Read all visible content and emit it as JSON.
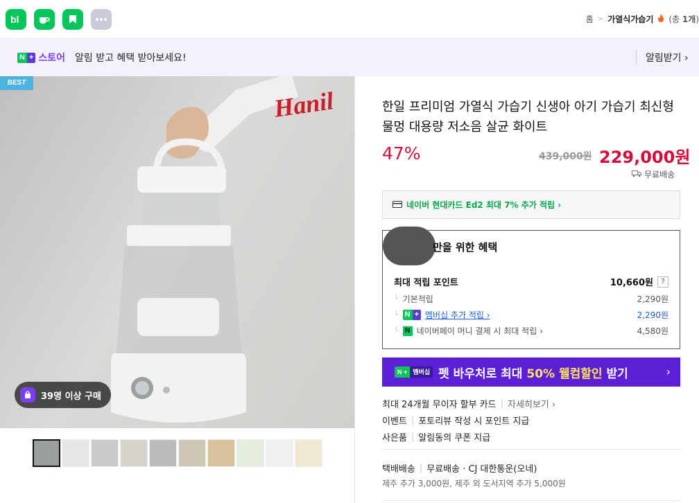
{
  "breadcrumb": {
    "home": "홈",
    "current": "가열식가습기",
    "count_prefix": "(총 ",
    "count_bold": "1개",
    "count_suffix": ")"
  },
  "notice": {
    "badge_n": "N",
    "badge_plus": "+",
    "store": "스토어",
    "message": "알림 받고 혜택 받아보세요!",
    "subscribe": "알림받기 ›"
  },
  "gallery": {
    "best_tag": "BEST",
    "brand_logo": "Hanil",
    "buyers": "39명 이상 구매",
    "thumb_count": 10
  },
  "product": {
    "title": "한일 프리미엄 가열식 가습기 신생아 아기 가습기 최신형 물멍 대용량 저소음 살균 화이트",
    "discount": "47%",
    "original_price": "439,000원",
    "price": "229,000원",
    "shipping": "무료배송"
  },
  "card_offer": {
    "text": "네이버 현대카드 Ed2 최대 7% 추가 적립 ›"
  },
  "benefit": {
    "header": "만을 위한 혜택",
    "max_points_label": "최대 적립 포인트",
    "max_points_value": "10,660원",
    "help": "?",
    "rows": [
      {
        "label": "기본적립",
        "value": "2,290원"
      },
      {
        "label": "멤버십 추가 적립 ›",
        "value": "2,290원"
      },
      {
        "label": "네이버페이 머니 결제 시 최대 적립 ›",
        "value": "4,580원"
      }
    ]
  },
  "promo": {
    "badge_n": "N +",
    "badge_m": "멤버십",
    "text_a": "펫 바우처로 최대 ",
    "text_hl": "50% 웰컴할인",
    "text_b": " 받기",
    "arrow": "›"
  },
  "info": {
    "installment": "최대 24개월 무이자 할부 카드",
    "installment_more": "자세히보기 ›",
    "event_label": "이벤트",
    "event_text": "포토리뷰 작성 시 포인트 지급",
    "gift_label": "사은품",
    "gift_text": "알림동의 쿠폰 지급",
    "delivery_label": "택배배송",
    "delivery_text": "무료배송 · CJ 대한통운(오네)",
    "delivery_extra": "제주 추가 3,000원, 제주 외 도서지역 추가 5,000원"
  },
  "colors": {
    "naver_green": "#03c75a",
    "price_red": "#d10f3a",
    "promo_purple": "#5b1fd6"
  }
}
